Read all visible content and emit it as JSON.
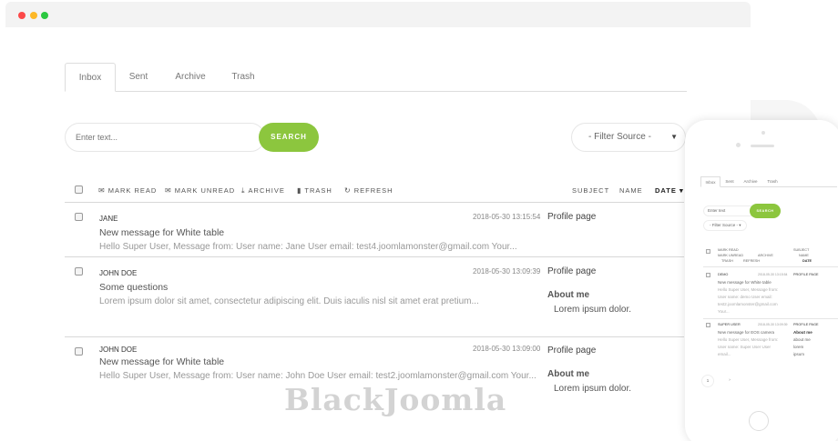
{
  "window": {
    "controls": [
      "close",
      "minimize",
      "maximize"
    ]
  },
  "tabs": [
    {
      "label": "Inbox",
      "active": true
    },
    {
      "label": "Sent",
      "active": false
    },
    {
      "label": "Archive",
      "active": false
    },
    {
      "label": "Trash",
      "active": false
    }
  ],
  "search": {
    "placeholder": "Enter text...",
    "button_label": "SEARCH"
  },
  "filter": {
    "selected": "- Filter Source -"
  },
  "toolbar": {
    "mark_read": "MARK READ",
    "mark_unread": "MARK UNREAD",
    "archive": "ARCHIVE",
    "trash": "TRASH",
    "refresh": "REFRESH",
    "sort": {
      "subject": "SUBJECT",
      "name": "NAME",
      "date": "DATE"
    }
  },
  "messages": [
    {
      "sender": "JANE",
      "date": "2018-05-30 13:15:54",
      "subject": "New message for White table",
      "preview": "Hello Super User, Message from: User name: Jane User email: test4.joomlamonster@gmail.com Your...",
      "col_subject": "Profile page",
      "about_title": "",
      "about_text": ""
    },
    {
      "sender": "JOHN DOE",
      "date": "2018-05-30 13:09:39",
      "subject": "Some questions",
      "preview": "Lorem ipsum dolor sit amet, consectetur adipiscing elit. Duis iaculis nisl sit amet erat pretium...",
      "col_subject": "Profile page",
      "about_title": "About me",
      "about_text": "Lorem ipsum dolor."
    },
    {
      "sender": "JOHN DOE",
      "date": "2018-05-30 13:09:00",
      "subject": "New message for White table",
      "preview": "Hello Super User, Message from: User name: John Doe User email: test2.joomlamonster@gmail.com Your...",
      "col_subject": "Profile page",
      "about_title": "About me",
      "about_text": "Lorem ipsum dolor."
    }
  ],
  "watermark": "BlackJoomla",
  "mobile": {
    "tabs": [
      "Inbox",
      "Sent",
      "Archive",
      "Trash"
    ],
    "search_placeholder": "Enter text",
    "search_button": "SEARCH",
    "filter": "- Filter Source -",
    "toolbar": [
      "MARK READ",
      "MARK UNREAD",
      "ARCHIVE",
      "TRASH",
      "REFRESH"
    ],
    "sort": [
      "SUBJECT",
      "NAME",
      "DATE"
    ],
    "messages": [
      {
        "sender": "DEMO",
        "date": "2018-05-30 13:15:54",
        "subject": "New message for White table",
        "preview_lines": [
          "Hello Super User, Message from:",
          "User name: demo User email:",
          "test2.joomlamonster@gmail.com",
          "Your..."
        ],
        "col": [
          "PROFILE PAGE"
        ]
      },
      {
        "sender": "SUPER USER",
        "date": "2018-05-30 13:09:39",
        "subject": "New message for EOS camera",
        "preview_lines": [
          "Hello Super User, Message from:",
          "User name: Super User User",
          "email..."
        ],
        "col": [
          "PROFILE PAGE",
          "About me",
          "about me",
          "lorem",
          "ipsum"
        ]
      }
    ],
    "pagination": [
      "1",
      "›"
    ]
  },
  "colors": {
    "accent": "#8cc63e",
    "close": "#fc4949",
    "minimize": "#fdb827",
    "maximize": "#2bc840"
  }
}
